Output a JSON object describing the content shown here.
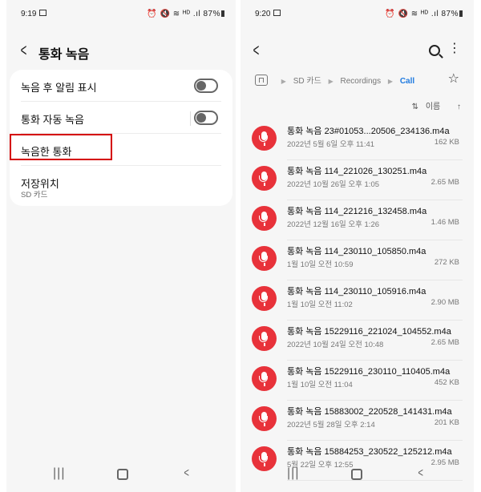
{
  "left": {
    "status": {
      "time": "9:19",
      "icons": "⏰ 🔇 ≋ ᴴᴰ .ıl 87%"
    },
    "title": "통화 녹음",
    "settings": [
      {
        "label": "녹음 후 알림 표시"
      },
      {
        "label": "통화 자동 녹음"
      },
      {
        "label": "녹음한 통화"
      },
      {
        "label": "저장위치",
        "sub": "SD 카드"
      }
    ]
  },
  "right": {
    "status": {
      "time": "9:20",
      "icons": "⏰ 🔇 ≋ ᴴᴰ .ıl 87%"
    },
    "breadcrumb": [
      "SD 카드",
      "Recordings",
      "Call"
    ],
    "sort_label": "이름",
    "files": [
      {
        "name": "통화 녹음 23#01053...20506_234136.m4a",
        "date": "2022년 5월 6일 오후 11:41",
        "size": "162 KB"
      },
      {
        "name": "통화 녹음 114_221026_130251.m4a",
        "date": "2022년 10월 26일 오후 1:05",
        "size": "2.65 MB"
      },
      {
        "name": "통화 녹음 114_221216_132458.m4a",
        "date": "2022년 12월 16일 오후 1:26",
        "size": "1.46 MB"
      },
      {
        "name": "통화 녹음 114_230110_105850.m4a",
        "date": "1월 10일 오전 10:59",
        "size": "272 KB"
      },
      {
        "name": "통화 녹음 114_230110_105916.m4a",
        "date": "1월 10일 오전 11:02",
        "size": "2.90 MB"
      },
      {
        "name": "통화 녹음 15229116_221024_104552.m4a",
        "date": "2022년 10월 24일 오전 10:48",
        "size": "2.65 MB"
      },
      {
        "name": "통화 녹음 15229116_230110_110405.m4a",
        "date": "1월 10일 오전 11:04",
        "size": "452 KB"
      },
      {
        "name": "통화 녹음 15883002_220528_141431.m4a",
        "date": "2022년 5월 28일 오후 2:14",
        "size": "201 KB"
      },
      {
        "name": "통화 녹음 15884253_230522_125212.m4a",
        "date": "5월 22일 오후 12:55",
        "size": "2.95 MB"
      }
    ]
  },
  "icons": {
    "back": "back-arrow-icon",
    "search": "search-icon",
    "more": "more-vert-icon",
    "star": "star-icon",
    "home": "home-folder-icon",
    "mic": "microphone-icon"
  },
  "colors": {
    "accent": "#1e7ae0",
    "recorder": "#e8323a",
    "highlight": "#d40000"
  }
}
